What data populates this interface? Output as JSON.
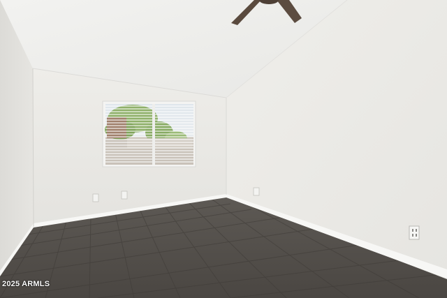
{
  "watermark": {
    "text": "2025 ARMLS"
  },
  "scene": {
    "subject": "empty-room",
    "objects": [
      "vaulted-ceiling",
      "ceiling-fan",
      "window-with-blinds",
      "baseboards",
      "tile-floor",
      "wall-outlets"
    ]
  },
  "colors": {
    "ceiling": "#efefed",
    "left_wall": "#e4e3df",
    "back_wall": "#eae9e5",
    "right_wall": "#ecebe7",
    "floor": "#54504b",
    "baseboard": "#f7f7f5",
    "fan_blade": "#5a4a3e",
    "foliage": "#8fb06a"
  }
}
